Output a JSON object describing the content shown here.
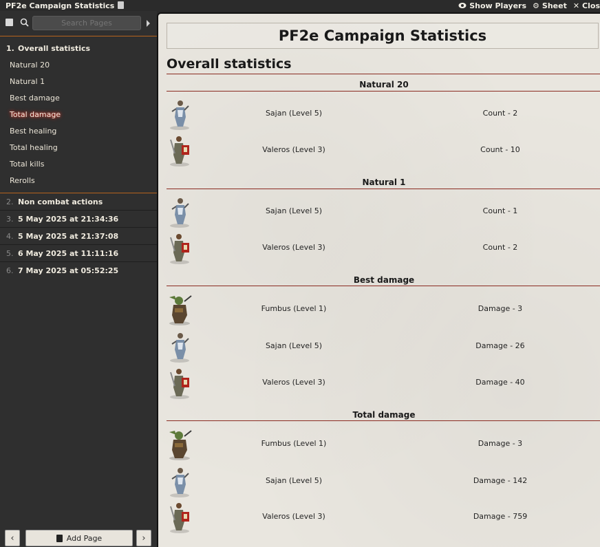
{
  "window": {
    "title": "PF2e Campaign Statistics",
    "controls": [
      {
        "icon": "eye-icon",
        "label": "Show Players"
      },
      {
        "icon": "gear-icon",
        "label": "Sheet"
      },
      {
        "icon": "close-icon",
        "label": "Clos"
      }
    ]
  },
  "sidebar": {
    "search_placeholder": "Search Pages",
    "sections": [
      {
        "num": "1.",
        "label": "Overall statistics"
      }
    ],
    "subitems": [
      {
        "label": "Natural 20"
      },
      {
        "label": "Natural 1"
      },
      {
        "label": "Best damage"
      },
      {
        "label": "Total damage",
        "active": true
      },
      {
        "label": "Best healing"
      },
      {
        "label": "Total healing"
      },
      {
        "label": "Total kills"
      },
      {
        "label": "Rerolls"
      }
    ],
    "pages": [
      {
        "num": "2.",
        "label": "Non combat actions"
      },
      {
        "num": "3.",
        "label": "5 May 2025 at 21:34:36"
      },
      {
        "num": "4.",
        "label": "5 May 2025 at 21:37:08"
      },
      {
        "num": "5.",
        "label": "6 May 2025 at 11:11:16"
      },
      {
        "num": "6.",
        "label": "7 May 2025 at 05:52:25"
      }
    ],
    "add_page_label": "Add Page",
    "prev_label": "‹",
    "next_label": "›"
  },
  "main": {
    "banner_title": "PF2e Campaign Statistics",
    "heading": "Overall statistics",
    "groups": [
      {
        "title": "Natural 20",
        "rows": [
          {
            "name": "Sajan (Level 5)",
            "stat": "Count - 2",
            "portrait": "monk"
          },
          {
            "name": "Valeros (Level 3)",
            "stat": "Count - 10",
            "portrait": "fighter"
          }
        ]
      },
      {
        "title": "Natural 1",
        "rows": [
          {
            "name": "Sajan (Level 5)",
            "stat": "Count - 1",
            "portrait": "monk"
          },
          {
            "name": "Valeros (Level 3)",
            "stat": "Count - 2",
            "portrait": "fighter"
          }
        ]
      },
      {
        "title": "Best damage",
        "rows": [
          {
            "name": "Fumbus (Level 1)",
            "stat": "Damage - 3",
            "portrait": "goblin"
          },
          {
            "name": "Sajan (Level 5)",
            "stat": "Damage - 26",
            "portrait": "monk"
          },
          {
            "name": "Valeros (Level 3)",
            "stat": "Damage - 40",
            "portrait": "fighter"
          }
        ]
      },
      {
        "title": "Total damage",
        "rows": [
          {
            "name": "Fumbus (Level 1)",
            "stat": "Damage - 3",
            "portrait": "goblin"
          },
          {
            "name": "Sajan (Level 5)",
            "stat": "Damage - 142",
            "portrait": "monk"
          },
          {
            "name": "Valeros (Level 3)",
            "stat": "Damage - 759",
            "portrait": "fighter"
          }
        ]
      }
    ]
  },
  "colors": {
    "accent_rule": "#8a2a20",
    "sidebar_divider": "#b8641d",
    "active_glow": "#e03a2a"
  }
}
